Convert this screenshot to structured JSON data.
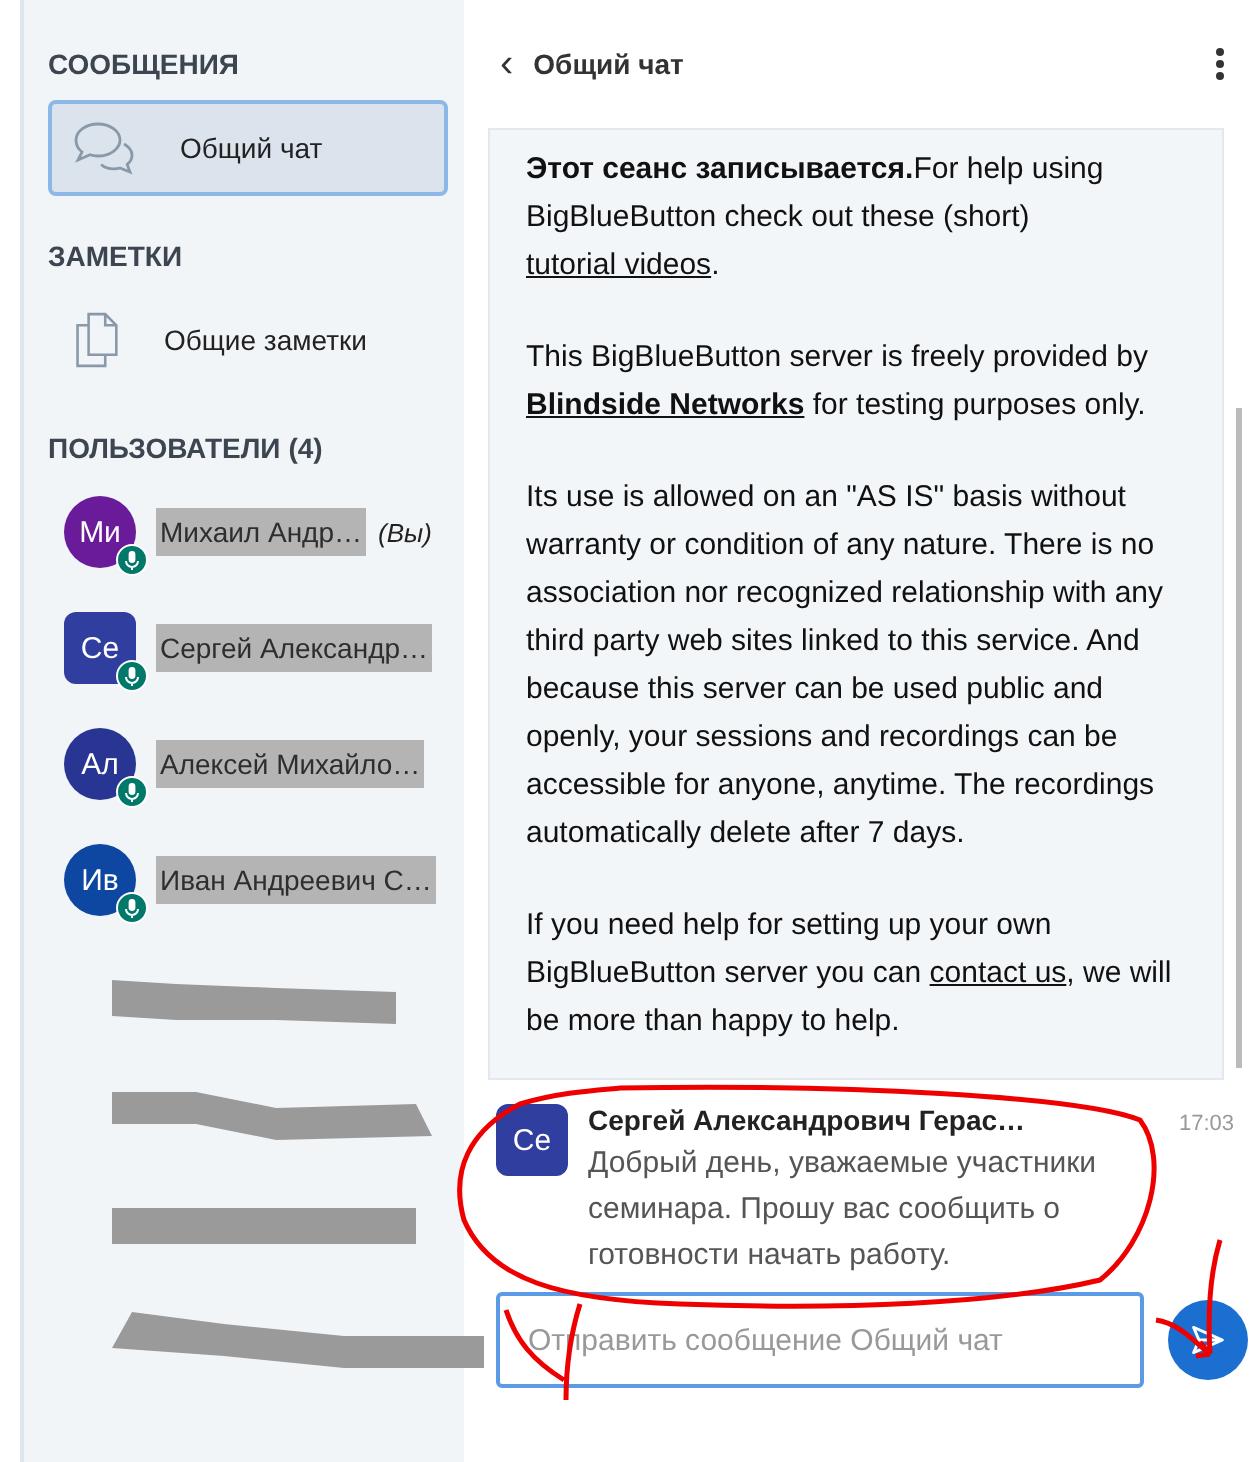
{
  "sidebar": {
    "messages_heading": "СООБЩЕНИЯ",
    "chats": [
      {
        "label": "Общий чат",
        "selected": true
      }
    ],
    "notes_heading": "ЗАМЕТКИ",
    "notes": [
      {
        "label": "Общие заметки"
      }
    ],
    "users_heading": "ПОЛЬЗОВАТЕЛИ",
    "users_count": "(4)",
    "users": [
      {
        "initials": "Ми",
        "name": "Михаил Андр…",
        "you": "(Вы)",
        "color": "#6a1b9a",
        "kind": "viewer"
      },
      {
        "initials": "Се",
        "name": "Сергей Александр…",
        "color": "#303f9f",
        "kind": "moderator"
      },
      {
        "initials": "Ал",
        "name": "Алексей Михайло…",
        "color": "#283593",
        "kind": "viewer"
      },
      {
        "initials": "Ив",
        "name": "Иван Андреевич С…",
        "color": "#0d47a1",
        "kind": "viewer"
      }
    ]
  },
  "chat": {
    "back": "‹",
    "title": "Общий чат",
    "welcome": [
      [
        {
          "kind": "bold",
          "text": "Этот сеанс записывается."
        },
        {
          "kind": "text",
          "text": "For help using BigBlueButton check out these (short) "
        },
        {
          "kind": "link",
          "text": "tutorial videos"
        },
        {
          "kind": "text",
          "text": "."
        }
      ],
      [
        {
          "kind": "text",
          "text": "This BigBlueButton server is freely provided by "
        },
        {
          "kind": "boldlink",
          "text": "Blindside Networks"
        },
        {
          "kind": "text",
          "text": " for testing purposes only."
        }
      ],
      [
        {
          "kind": "text",
          "text": "Its use is allowed on an \"AS IS\" basis without warranty or condition of any nature. There is no association nor recognized relationship with any third party web sites linked to this service. And because this server can be used public and openly, your sessions and recordings can be accessible for anyone, anytime. The recordings automatically delete after 7 days."
        }
      ],
      [
        {
          "kind": "text",
          "text": "If you need help for setting up your own BigBlueButton server you can "
        },
        {
          "kind": "link",
          "text": "contact us"
        },
        {
          "kind": "text",
          "text": ", we will be more than happy to help."
        }
      ]
    ],
    "message": {
      "initials": "Се",
      "color": "#303f9f",
      "author": "Сергей Александрович Герас…",
      "time": "17:03",
      "text": "Добрый день, уважаемые участники семинара. Прошу вас сообщить о готовности начать работу."
    },
    "input": {
      "placeholder": "Отправить сообщение Общий чат"
    }
  }
}
